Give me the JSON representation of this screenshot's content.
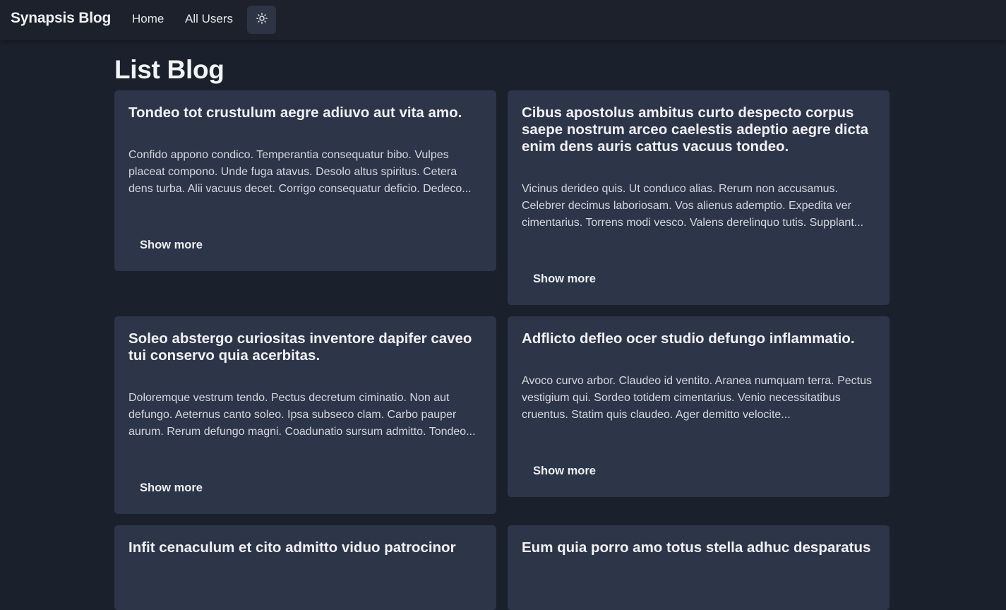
{
  "navbar": {
    "brand": "Synapsis Blog",
    "links": [
      {
        "label": "Home"
      },
      {
        "label": "All Users"
      }
    ],
    "theme_toggle_icon": "sun-icon"
  },
  "page": {
    "title": "List Blog"
  },
  "posts": [
    {
      "title": "Tondeo tot crustulum aegre adiuvo aut vita amo.",
      "body": "Confido appono condico. Temperantia consequatur bibo. Vulpes placeat compono. Unde fuga atavus. Desolo altus spiritus. Cetera dens turba. Alii vacuus decet. Corrigo consequatur deficio. Dedeco...",
      "button": "Show more"
    },
    {
      "title": "Cibus apostolus ambitus curto despecto corpus saepe nostrum arceo caelestis adeptio aegre dicta enim dens auris cattus vacuus tondeo.",
      "body": "Vicinus derideo quis. Ut conduco alias. Rerum non accusamus. Celebrer decimus laboriosam. Vos alienus ademptio. Expedita ver cimentarius. Torrens modi vesco. Valens derelinquo tutis. Supplant...",
      "button": "Show more"
    },
    {
      "title": "Soleo abstergo curiositas inventore dapifer caveo tui conservo quia acerbitas.",
      "body": "Doloremque vestrum tendo. Pectus decretum ciminatio. Non aut defungo. Aeternus canto soleo. Ipsa subseco clam. Carbo pauper aurum. Rerum defungo magni. Coadunatio sursum admitto. Tondeo...",
      "button": "Show more"
    },
    {
      "title": "Adflicto defleo ocer studio defungo inflammatio.",
      "body": "Avoco curvo arbor. Claudeo id ventito. Aranea numquam terra. Pectus vestigium qui. Sordeo totidem cimentarius. Venio necessitatibus cruentus. Statim quis claudeo. Ager demitto velocite...",
      "button": "Show more"
    },
    {
      "title": "Infit cenaculum et cito admitto viduo patrocinor"
    },
    {
      "title": "Eum quia porro amo totus stella adhuc desparatus"
    }
  ],
  "colors": {
    "background": "#1a202c",
    "navbar": "#1c212c",
    "card": "#2d3548",
    "toggle": "#2d3443"
  }
}
